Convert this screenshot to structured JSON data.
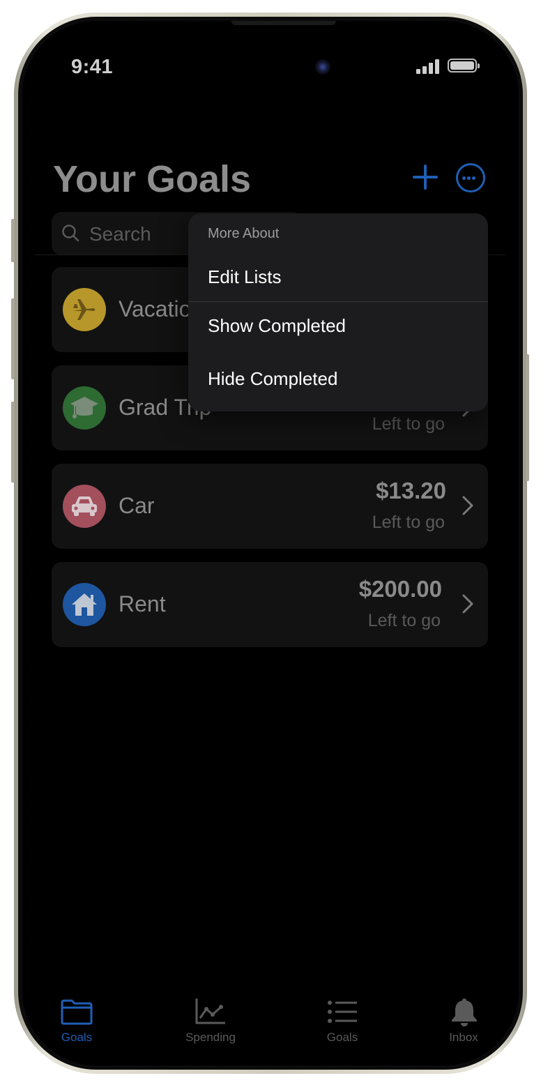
{
  "status_bar": {
    "time": "9:41"
  },
  "header": {
    "title": "Your Goals"
  },
  "search": {
    "placeholder": "Search"
  },
  "goals": [
    {
      "name": "Vacatio",
      "icon": "airplane-icon",
      "color": "#b8972a"
    },
    {
      "name": "Grad Trip",
      "sub": "Left to go",
      "icon": "graduation-cap-icon",
      "color": "#2e6b33"
    },
    {
      "name": "Car",
      "amount": "$13.20",
      "sub": "Left to go",
      "icon": "car-icon",
      "color": "#a34f5c"
    },
    {
      "name": "Rent",
      "amount": "$200.00",
      "sub": "Left to go",
      "icon": "house-icon",
      "color": "#1e56a0"
    }
  ],
  "menu": {
    "header": "More About",
    "items": [
      "Edit Lists",
      "Show Completed",
      "Hide Completed"
    ]
  },
  "tabbar": {
    "tabs": [
      {
        "label": "Goals",
        "icon": "folder-icon"
      },
      {
        "label": "Spending",
        "icon": "chart-line-icon"
      },
      {
        "label": "Goals",
        "icon": "list-icon"
      },
      {
        "label": "Inbox",
        "icon": "bell-icon"
      }
    ]
  },
  "colors": {
    "accent": "#1f5fb4",
    "background": "#000000",
    "menu": "#1c1c1e"
  }
}
